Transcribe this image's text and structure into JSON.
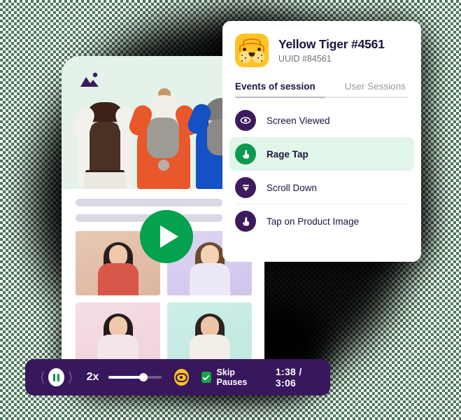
{
  "session_card": {
    "avatar_icon": "tiger-avatar-icon",
    "title": "Yellow Tiger #4561",
    "uuid": "UUID #84561",
    "tabs": [
      {
        "label": "Events of session",
        "active": true
      },
      {
        "label": "User Sessions",
        "active": false
      }
    ],
    "events": [
      {
        "label": "Screen Viewed",
        "icon": "eye-icon",
        "highlighted": false
      },
      {
        "label": "Rage Tap",
        "icon": "tap-hand-icon",
        "highlighted": true
      },
      {
        "label": "Scroll Down",
        "icon": "scroll-down-icon",
        "highlighted": false
      },
      {
        "label": "Tap on Product Image",
        "icon": "tap-hand-icon",
        "highlighted": false
      }
    ]
  },
  "phone": {
    "header_icon": "image-placeholder-icon",
    "search_icon": "search-icon",
    "play_icon": "play-icon"
  },
  "player": {
    "prev_icon": "chevron-left-icon",
    "pause_icon": "pause-icon",
    "next_icon": "chevron-right-icon",
    "speed": "2x",
    "volume_icon": "volume-slider",
    "eye_icon": "eye-icon",
    "skip_pauses_label": "Skip Pauses",
    "skip_pauses_checked": true,
    "time": "1:38 / 3:06"
  },
  "colors": {
    "purple_dark": "#38175c",
    "purple_navy": "#1b1340",
    "green": "#0a9a4e",
    "green_play": "#04a24e",
    "green_highlight": "#e2f5e9",
    "amber": "#ffc324",
    "hero_mint": "#e4f2ea"
  }
}
